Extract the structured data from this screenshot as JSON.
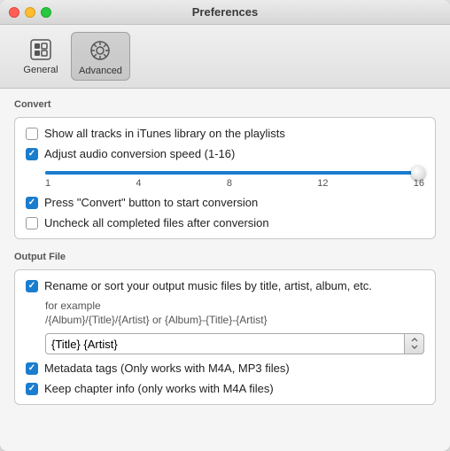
{
  "window": {
    "title": "Preferences"
  },
  "toolbar": {
    "general": {
      "label": "General",
      "icon": "⊟"
    },
    "advanced": {
      "label": "Advanced",
      "icon": "⚙"
    }
  },
  "convert_section": {
    "title": "Convert",
    "options": [
      {
        "id": "show-tracks",
        "label": "Show all tracks in iTunes library on the playlists",
        "checked": false
      },
      {
        "id": "adjust-speed",
        "label": "Adjust audio conversion speed (1-16)",
        "checked": true
      },
      {
        "id": "press-convert",
        "label": "Press \"Convert\" button to start conversion",
        "checked": true
      },
      {
        "id": "uncheck-completed",
        "label": "Uncheck all completed files after conversion",
        "checked": false
      }
    ],
    "slider": {
      "min": "1",
      "step1": "4",
      "step2": "8",
      "step3": "12",
      "max": "16",
      "value": 100
    }
  },
  "output_section": {
    "title": "Output File",
    "rename_label": "Rename or sort your output music files by title, artist, album, etc.",
    "rename_checked": true,
    "example_label": "for example",
    "example_path": "/{Album}/{Title}/{Artist} or {Album}-{Title}-{Artist}",
    "input_value": "{Title} {Artist}",
    "metadata_label": "Metadata tags (Only works with M4A, MP3 files)",
    "metadata_checked": true,
    "chapter_label": "Keep chapter info (only works with  M4A files)",
    "chapter_checked": true
  }
}
